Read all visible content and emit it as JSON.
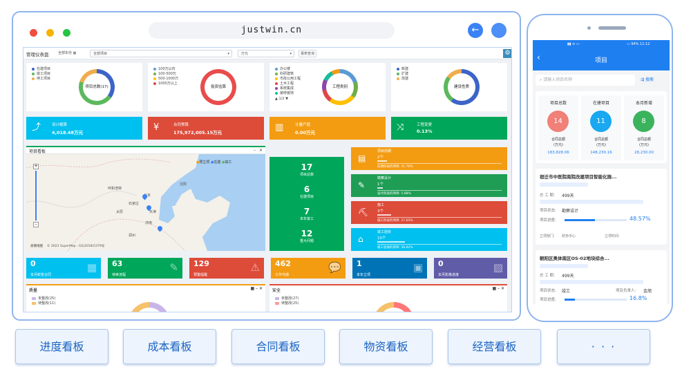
{
  "browser": {
    "url": "justwin.cn",
    "back_icon": "arrow-left-icon",
    "colors": {
      "close": "#f04e3e",
      "minimize": "#f6b300",
      "maximize": "#27c443",
      "frame": "#8fb4ee"
    }
  },
  "dashboard": {
    "title": "管理仪表盘",
    "year_filter": "全部年份",
    "project_select": "全部项目",
    "unit_select": "万元",
    "query_button": "报表查询",
    "summary_cards": [
      {
        "legend": [
          "在建项目",
          "竣工项目",
          "停工项目"
        ],
        "center": "项目总数(17)"
      },
      {
        "legend": [
          "100万以内",
          "100-500万",
          "500-1000万",
          "1000万以上"
        ],
        "center": "投资估算"
      },
      {
        "legend": [
          "办公楼",
          "科研建筑",
          "市政公用工程",
          "土木工程",
          "系统集成",
          "装修装饰"
        ],
        "center": "工程类别",
        "pager": "1/2"
      },
      {
        "legend": [
          "新建",
          "扩建",
          "改建"
        ],
        "center": "建设性质"
      }
    ],
    "stats": [
      {
        "label": "设计概算",
        "value": "4,018.48万元",
        "icon": "chart-icon"
      },
      {
        "label": "合同预算",
        "value": "175,972,005.15万元",
        "icon": "yen-icon"
      },
      {
        "label": "计量产值",
        "value": "0.00万元",
        "icon": "bar-chart-icon"
      },
      {
        "label": "工程变更",
        "value": "0.13%",
        "icon": "shuffle-icon"
      }
    ],
    "map_panel": {
      "title": "项目看板",
      "legend": [
        "预立项",
        "在建",
        "竣工"
      ],
      "cities": [
        "呼和浩特",
        "太原",
        "石家庄",
        "北京",
        "天津",
        "济南",
        "郑州",
        "沈阳"
      ],
      "copyright": "© 2023 SuperMap - GS(2018)5379号",
      "logo": "高德地图"
    },
    "green_panel": [
      {
        "value": "17",
        "label": "项目总数"
      },
      {
        "value": "6",
        "label": "在建项目"
      },
      {
        "value": "7",
        "label": "本年竣工"
      },
      {
        "value": "12",
        "label": "重大问题"
      }
    ],
    "kpis": [
      {
        "title": "项目前期",
        "count": "2个",
        "detail": "前期阶段的项目: 11.76%",
        "color": "#f39c12",
        "icon": "doc-icon"
      },
      {
        "title": "勘察设计",
        "count": "1个",
        "detail": "设计阶段的项目: 5.88%",
        "color": "#1f9d55",
        "icon": "ruler-icon"
      },
      {
        "title": "施工",
        "count": "3个",
        "detail": "施工阶段的项目: 17.65%",
        "color": "#dd4b39",
        "icon": "excavator-icon"
      },
      {
        "title": "竣工验收",
        "count": "10个",
        "detail": "竣工验收的项目: 58.82%",
        "color": "#00c0ef",
        "icon": "house-check-icon"
      }
    ],
    "tiles": [
      {
        "value": "0",
        "label": "本月新签合同",
        "color": "#00c0ef",
        "icon": "newspaper-icon"
      },
      {
        "value": "63",
        "label": "待审流程",
        "color": "#00a65a",
        "icon": "edit-icon"
      },
      {
        "value": "129",
        "label": "预警提醒",
        "color": "#dd4b39",
        "icon": "warning-icon"
      },
      {
        "value": "462",
        "label": "工作沟通",
        "color": "#f39c12",
        "icon": "chat-icon"
      },
      {
        "value": "1",
        "label": "本年立项",
        "color": "#0073b7",
        "icon": "cubes-icon"
      },
      {
        "value": "0",
        "label": "本月影像进度",
        "color": "#605ca8",
        "icon": "image-icon"
      }
    ],
    "quality_panel": {
      "title": "质量",
      "legend": [
        "未整改(25)",
        "待整改(11)"
      ]
    },
    "safety_panel": {
      "title": "安全",
      "legend": [
        "未整改(27)",
        "待整改(25)"
      ]
    }
  },
  "phone": {
    "status": {
      "battery": "94%",
      "time": "11:12"
    },
    "header_title": "项目",
    "search_placeholder": "请输入项目名称",
    "search_label": "搜索",
    "summary": [
      {
        "title": "项目总数",
        "count": "14",
        "sub": "合同总额",
        "unit": "(万元)",
        "amount": "183,828.06",
        "color": "#f08078"
      },
      {
        "title": "在建项目",
        "count": "11",
        "sub": "合同总额",
        "unit": "(万元)",
        "amount": "148,230.16",
        "color": "#1aa8f0"
      },
      {
        "title": "本月新增",
        "count": "8",
        "sub": "合同总额",
        "unit": "(万元)",
        "amount": "28,230.00",
        "color": "#3bb35c"
      }
    ],
    "projects": [
      {
        "name": "宿迁市中医院南院改建项目智能化施...",
        "duration_label": "总 工 期:",
        "duration": "499天",
        "status_label": "项目状态:",
        "status": "勘察设计",
        "progress_label": "项目进度:",
        "progress": 48.57,
        "progress_text": "48.57%",
        "dept_label": "立项部门:",
        "dept": "财务中心",
        "time_label": "立项时间:"
      },
      {
        "name": "朝阳区奥体南区OS-02地块综合...",
        "duration_label": "总 工 期:",
        "duration": "499天",
        "status_label": "项目状态:",
        "status": "竣工",
        "owner_label": "项目负责人:",
        "owner": "金旭",
        "progress_label": "项目进度:",
        "progress": 16.8,
        "progress_text": "16.8%"
      }
    ]
  },
  "bottom_tabs": [
    "进度看板",
    "成本看板",
    "合同看板",
    "物资看板",
    "经营看板",
    "· · ·"
  ]
}
